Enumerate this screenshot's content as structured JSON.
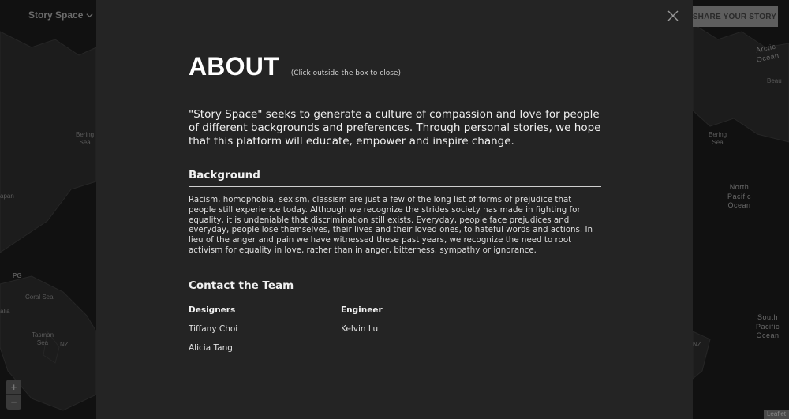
{
  "app": {
    "brand": "Story Space",
    "share_button": "SHARE YOUR STORY",
    "attribution": "Leaflet",
    "zoom": {
      "in": "+",
      "out": "−"
    }
  },
  "map_labels": {
    "arctic_ocean": "Arctic Ocean",
    "bering_sea_left": "Bering\nSea",
    "bering_sea_right": "Bering\nSea",
    "beaufort": "Beau",
    "japan": "apan",
    "png": "PG",
    "coral_sea": "Coral Sea",
    "australia": "alia",
    "tasman_sea": "Tasman\nSea",
    "nz_left": "NZ",
    "nz_right": "NZ",
    "north_pacific": "North\nPacific\nOcean",
    "south_pacific": "South\nPacific\nOcean"
  },
  "modal": {
    "title": "ABOUT",
    "hint": "(Click outside the box to close)",
    "intro": "\"Story Space\" seeks to generate a culture of compassion and love for people of different backgrounds and preferences. Through personal stories, we hope that this platform will educate, empower and inspire change.",
    "background": {
      "heading": "Background",
      "text": "Racism, homophobia, sexism, classism are just a few of the long list of forms of prejudice that people still experience today. Although we recognize the strides society has made in fighting for equality, it is undeniable that discrimination still exists. Everyday, people face prejudices and everyday, people lose themselves, their lives and their loved ones, to hateful words and actions. In lieu of the anger and pain we have witnessed these past years, we recognize the need to root activism for equality in love, rather than in anger, bitterness, sympathy or ignorance."
    },
    "contact": {
      "heading": "Contact the Team",
      "designers": {
        "heading": "Designers",
        "members": [
          "Tiffany Choi",
          "Alicia Tang"
        ]
      },
      "engineer": {
        "heading": "Engineer",
        "members": [
          "Kelvin Lu"
        ]
      }
    }
  },
  "colors": {
    "modal_bg": "#242424",
    "map_bg": "#111111",
    "land": "#1e1e1e",
    "text": "#e8e8e8"
  }
}
